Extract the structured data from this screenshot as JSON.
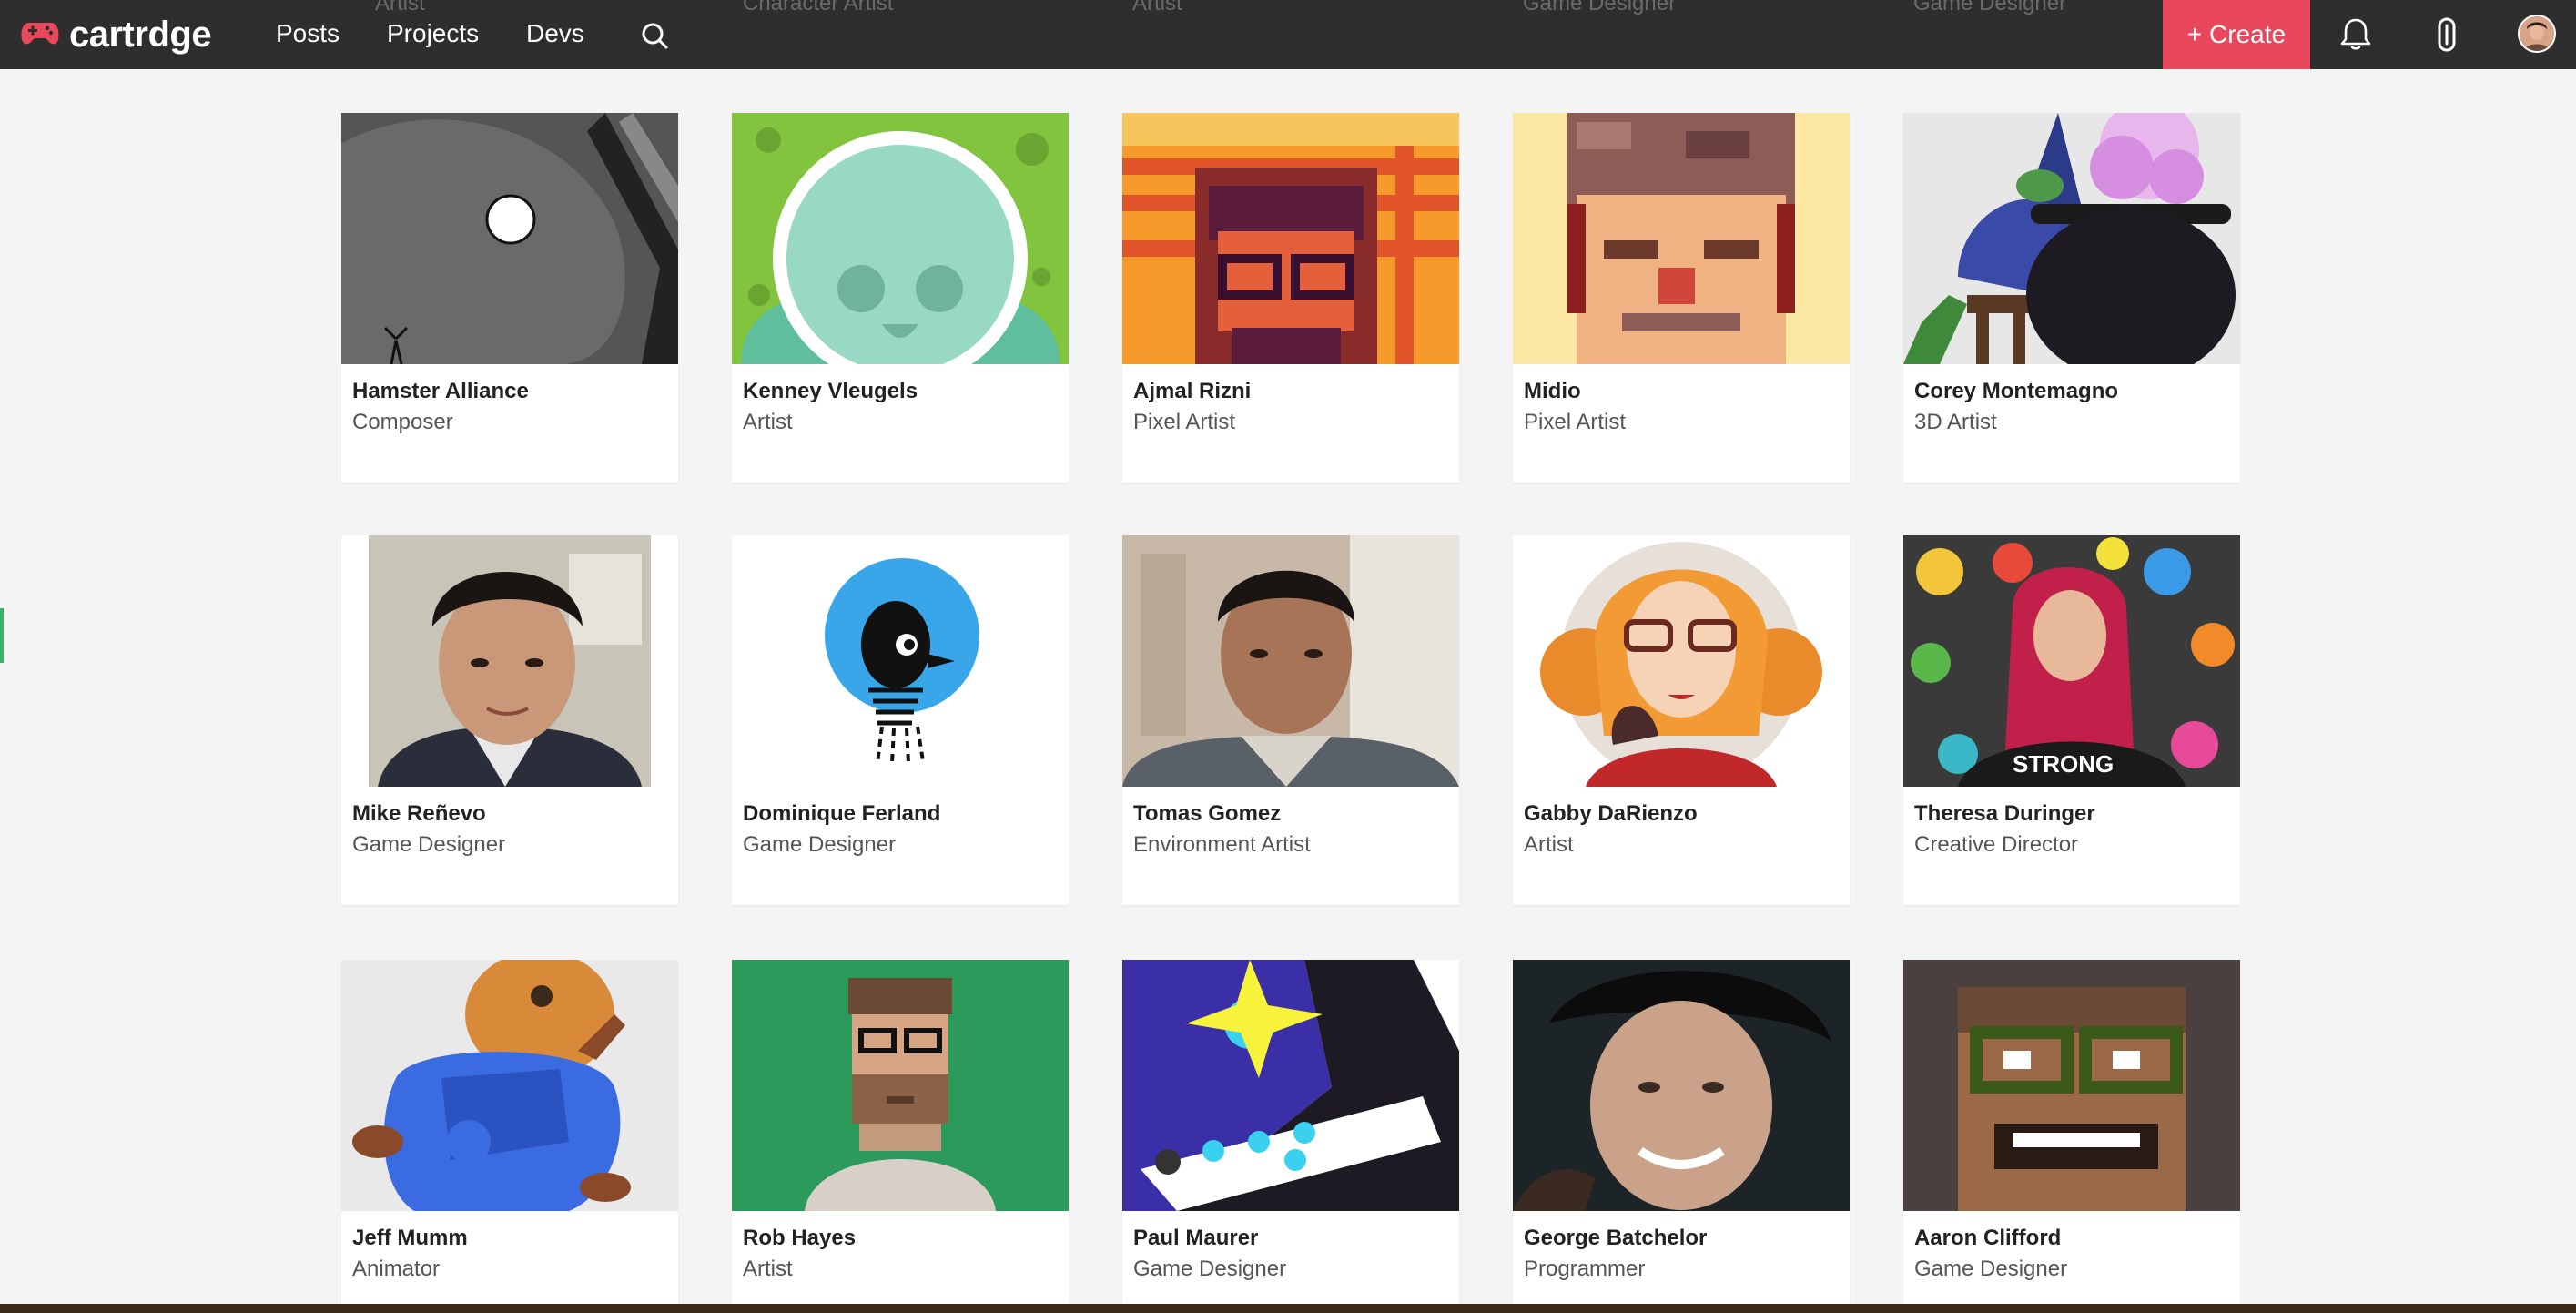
{
  "brand": {
    "name": "cartrdge",
    "accent": "#e8475c"
  },
  "nav": {
    "links": [
      "Posts",
      "Projects",
      "Devs"
    ],
    "create_label": "+ Create"
  },
  "ghost_roles": [
    "Artist",
    "Character Artist",
    "Artist",
    "Game Designer",
    "Game Designer"
  ],
  "icons": {
    "search": "search-icon",
    "notifications": "bell-icon",
    "messages": "clip-icon",
    "profile": "avatar"
  },
  "devs": [
    {
      "name": "Hamster Alliance",
      "role": "Composer"
    },
    {
      "name": "Kenney Vleugels",
      "role": "Artist"
    },
    {
      "name": "Ajmal Rizni",
      "role": "Pixel Artist"
    },
    {
      "name": "Midio",
      "role": "Pixel Artist"
    },
    {
      "name": "Corey Montemagno",
      "role": "3D Artist"
    },
    {
      "name": "Mike Reñevo",
      "role": "Game Designer"
    },
    {
      "name": "Dominique Ferland",
      "role": "Game Designer"
    },
    {
      "name": "Tomas Gomez",
      "role": "Environment Artist"
    },
    {
      "name": "Gabby DaRienzo",
      "role": "Artist"
    },
    {
      "name": "Theresa Duringer",
      "role": "Creative Director"
    },
    {
      "name": "Jeff Mumm",
      "role": "Animator"
    },
    {
      "name": "Rob Hayes",
      "role": "Artist"
    },
    {
      "name": "Paul Maurer",
      "role": "Game Designer"
    },
    {
      "name": "George Batchelor",
      "role": "Programmer"
    },
    {
      "name": "Aaron Clifford",
      "role": "Game Designer"
    }
  ]
}
